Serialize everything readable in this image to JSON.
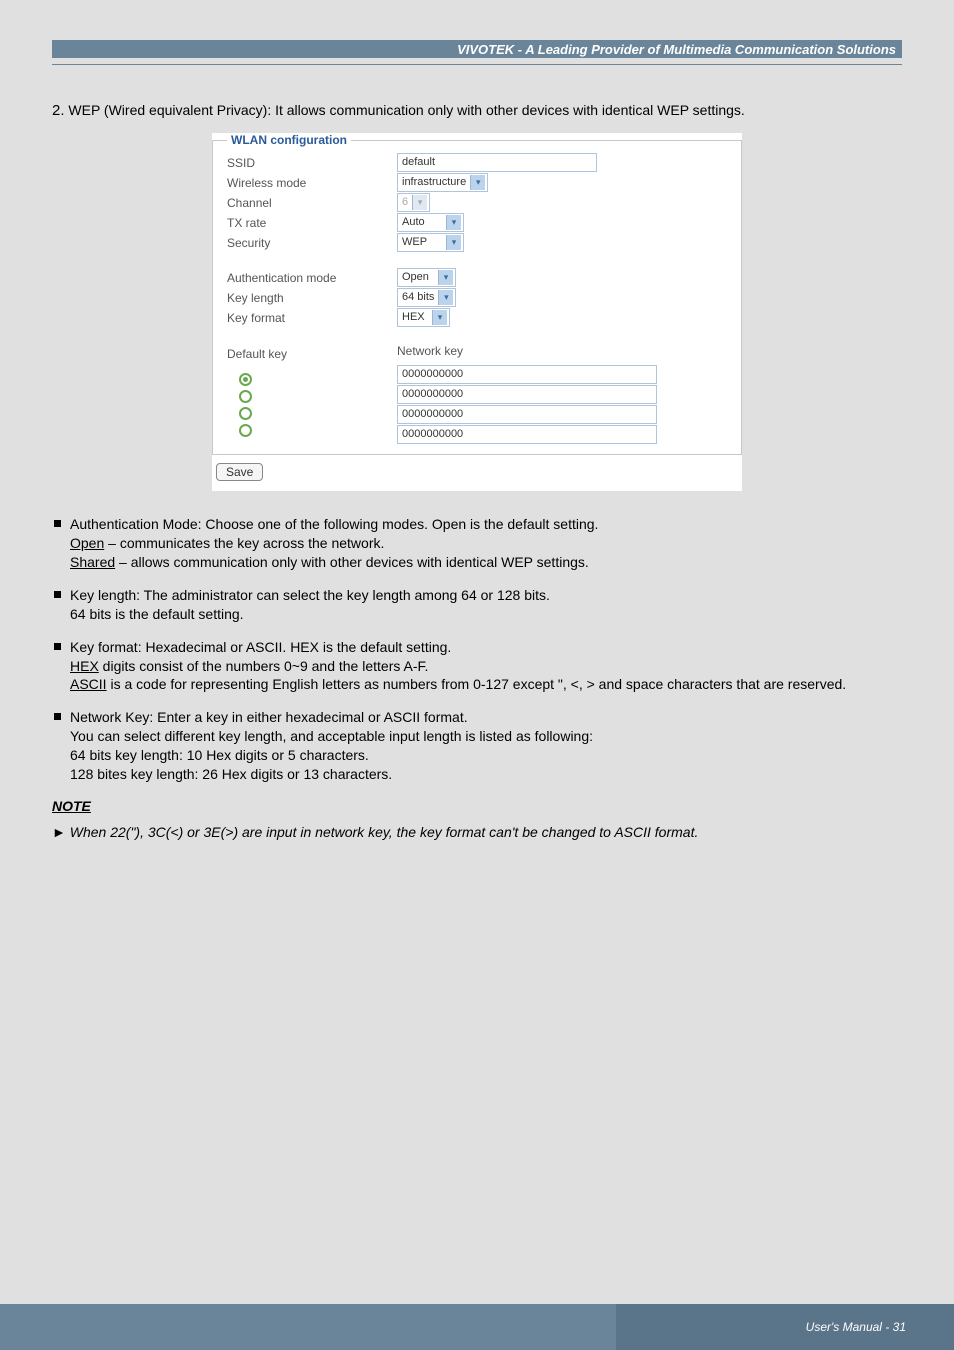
{
  "header": {
    "title": "VIVOTEK - A Leading Provider of Multimedia Communication Solutions"
  },
  "intro": {
    "number": "2.",
    "text": "WEP (Wired equivalent Privacy): It allows communication only with other devices with identical WEP settings."
  },
  "wlan": {
    "legend": "WLAN configuration",
    "fields": {
      "ssid": {
        "label": "SSID",
        "value": "default"
      },
      "wireless_mode": {
        "label": "Wireless mode",
        "value": "infrastructure"
      },
      "channel": {
        "label": "Channel",
        "value": "6"
      },
      "tx_rate": {
        "label": "TX rate",
        "value": "Auto"
      },
      "security": {
        "label": "Security",
        "value": "WEP"
      },
      "auth_mode": {
        "label": "Authentication mode",
        "value": "Open"
      },
      "key_length": {
        "label": "Key length",
        "value": "64 bits"
      },
      "key_format": {
        "label": "Key format",
        "value": "HEX"
      },
      "default_key": {
        "label": "Default key",
        "header": "Network key"
      }
    },
    "keys": [
      {
        "selected": true,
        "value": "0000000000"
      },
      {
        "selected": false,
        "value": "0000000000"
      },
      {
        "selected": false,
        "value": "0000000000"
      },
      {
        "selected": false,
        "value": "0000000000"
      }
    ],
    "save": "Save"
  },
  "bullets": {
    "auth": {
      "lead": "Authentication Mode: Choose one of the following modes. Open is the default setting.",
      "open_label": "Open",
      "open_desc": " – communicates the key across the network.",
      "shared_label": "Shared",
      "shared_desc": " – allows communication only with other devices with identical WEP settings."
    },
    "keylen": {
      "line1": "Key length: The administrator can select the key length among 64 or 128 bits.",
      "line2": "64 bits is the default setting."
    },
    "keyfmt": {
      "line1": "Key format: Hexadecimal or ASCII. HEX is the default setting.",
      "hex_label": "HEX",
      "hex_desc": " digits consist of the numbers 0~9 and the letters A-F.",
      "ascii_label": "ASCII",
      "ascii_desc": " is a code for representing English letters as numbers from 0-127 except \", <, > and space characters that are reserved."
    },
    "netkey": {
      "line1": "Network Key: Enter a key in either hexadecimal or ASCII format.",
      "line2": "You can select different key length,  and acceptable input length is listed as following:",
      "line3": "64 bits key length: 10 Hex digits or 5 characters.",
      "line4": "128 bites key length: 26 Hex digits or 13 characters."
    }
  },
  "note": {
    "heading": "NOTE",
    "arrow": "►",
    "text": "When 22(\"), 3C(<) or 3E(>) are input in network key, the key format can't be changed to ASCII format."
  },
  "footer": {
    "text": "User's Manual - 31"
  }
}
